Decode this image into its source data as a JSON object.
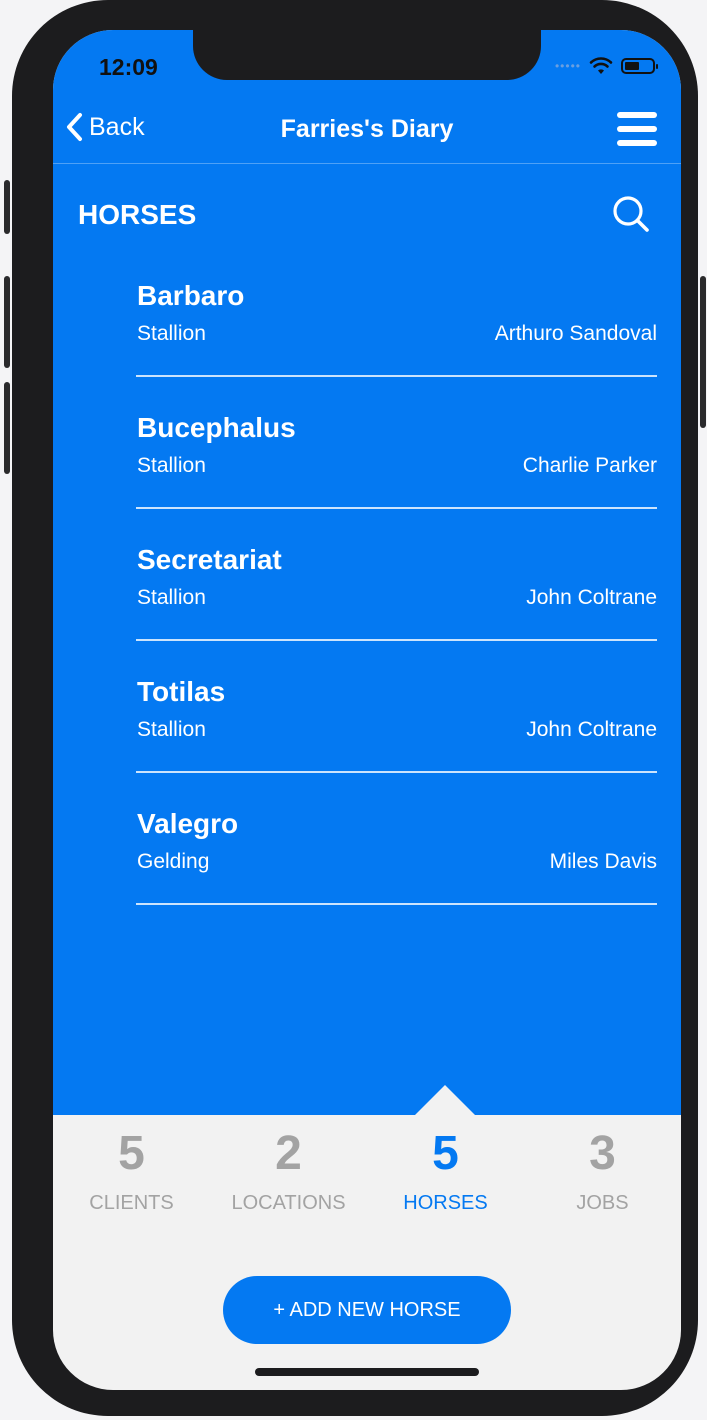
{
  "status": {
    "time": "12:09"
  },
  "nav": {
    "back_label": "Back",
    "title": "Farries's Diary"
  },
  "section": {
    "title": "HORSES"
  },
  "horses": [
    {
      "name": "Barbaro",
      "type": "Stallion",
      "owner": "Arthuro Sandoval"
    },
    {
      "name": "Bucephalus",
      "type": "Stallion",
      "owner": "Charlie Parker"
    },
    {
      "name": "Secretariat",
      "type": "Stallion",
      "owner": "John Coltrane"
    },
    {
      "name": "Totilas",
      "type": "Stallion",
      "owner": "John Coltrane"
    },
    {
      "name": "Valegro",
      "type": "Gelding",
      "owner": "Miles Davis"
    }
  ],
  "tabs": [
    {
      "count": "5",
      "label": "CLIENTS"
    },
    {
      "count": "2",
      "label": "LOCATIONS"
    },
    {
      "count": "5",
      "label": "HORSES"
    },
    {
      "count": "3",
      "label": "JOBS"
    }
  ],
  "add_button": {
    "label": "+ ADD NEW HORSE"
  },
  "colors": {
    "primary": "#0479f2",
    "inactive": "#a3a3a3",
    "footer_bg": "#f2f2f2"
  },
  "icons": [
    "back-chevron-icon",
    "menu-icon",
    "search-icon",
    "wifi-icon",
    "battery-icon"
  ]
}
